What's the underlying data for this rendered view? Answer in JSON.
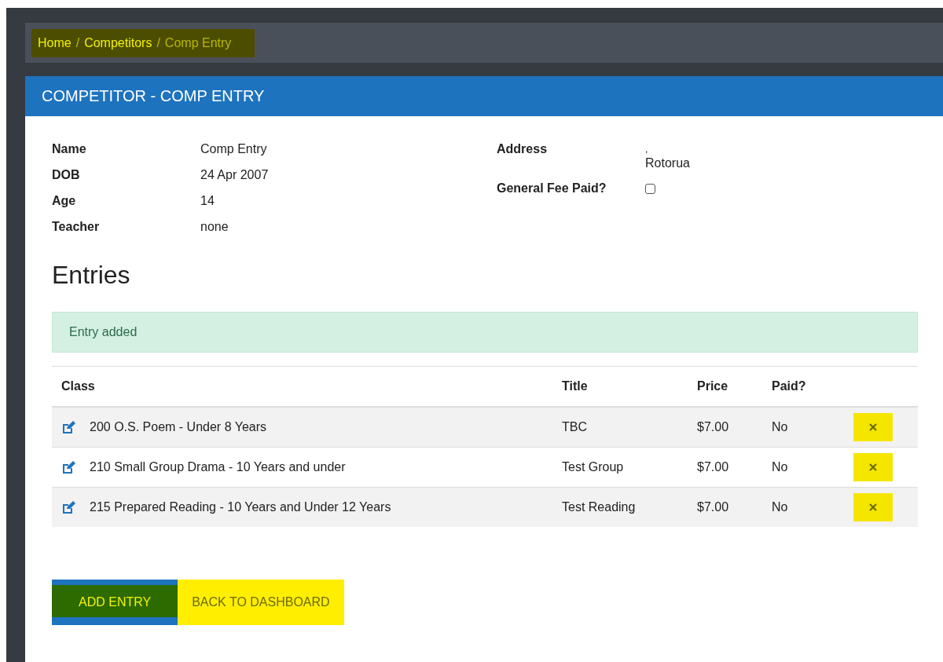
{
  "breadcrumb": {
    "highlighted": true,
    "separator": "/",
    "items": [
      {
        "label": "Home",
        "current": false
      },
      {
        "label": "Competitors",
        "current": false
      },
      {
        "label": "Comp Entry",
        "current": true
      }
    ]
  },
  "panel": {
    "title": "COMPETITOR - COMP ENTRY"
  },
  "details_left": [
    {
      "label": "Name",
      "value": "Comp Entry"
    },
    {
      "label": "DOB",
      "value": "24 Apr 2007"
    },
    {
      "label": "Age",
      "value": "14"
    },
    {
      "label": "Teacher",
      "value": "none"
    }
  ],
  "address": {
    "label": "Address",
    "lines": [
      ",",
      "Rotorua"
    ]
  },
  "general_fee": {
    "label": "General Fee Paid?",
    "checked": false
  },
  "entries_heading": "Entries",
  "alert": "Entry added",
  "table": {
    "columns": [
      "Class",
      "Title",
      "Price",
      "Paid?"
    ],
    "rows": [
      {
        "class": "200 O.S. Poem - Under 8 Years",
        "title": "TBC",
        "price": "$7.00",
        "paid": "No",
        "delete_highlighted": true
      },
      {
        "class": "210 Small Group Drama - 10 Years and under",
        "title": "Test Group",
        "price": "$7.00",
        "paid": "No",
        "delete_highlighted": true
      },
      {
        "class": "215 Prepared Reading - 10 Years and Under 12 Years",
        "title": "Test Reading",
        "price": "$7.00",
        "paid": "No",
        "delete_highlighted": true
      }
    ]
  },
  "buttons": [
    {
      "label": "ADD ENTRY",
      "kind": "primary",
      "highlighted": true
    },
    {
      "label": "BACK TO DASHBOARD",
      "kind": "link",
      "highlighted": true
    }
  ]
}
